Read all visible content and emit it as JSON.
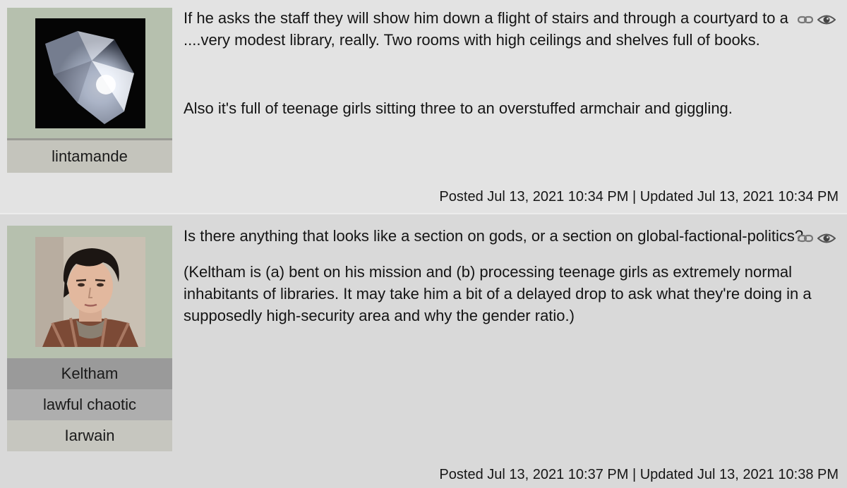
{
  "posts": [
    {
      "character": {
        "author": "lintamande"
      },
      "avatar": "diamond-avatar",
      "paragraphs": [
        "If he asks the staff they will show him down a flight of stairs and through a courtyard to a ....very modest library, really. Two rooms with high ceilings and shelves full of books.",
        "Also it's full of teenage girls sitting three to an overstuffed armchair and giggling."
      ],
      "icons": [
        "link-icon",
        "eye-icon"
      ],
      "footer": "Posted Jul 13, 2021 10:34 PM | Updated Jul 13, 2021 10:34 PM"
    },
    {
      "character": {
        "name": "Keltham",
        "alias": "lawful chaotic",
        "author": "Iarwain"
      },
      "avatar": "keltham-portrait-avatar",
      "paragraphs": [
        "Is there anything that looks like a section on gods, or a section on global-factional-politics?",
        "(Keltham is (a) bent on his mission and (b) processing teenage girls as extremely normal inhabitants of libraries.  It may take him a bit of a delayed drop to ask what they're doing in a supposedly high-security area and why the gender ratio.)"
      ],
      "icons": [
        "link-icon",
        "eye-icon"
      ],
      "footer": "Posted Jul 13, 2021 10:37 PM | Updated Jul 13, 2021 10:38 PM"
    }
  ]
}
